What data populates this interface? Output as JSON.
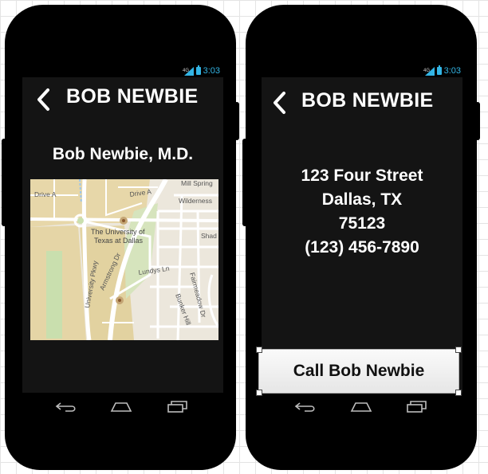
{
  "screens": [
    {
      "status": {
        "time": "3:03",
        "network": "4G"
      },
      "title": "BOB NEWBIE",
      "doctor_name": "Bob Newbie, M.D.",
      "map_labels": {
        "drive_a_1": "Drive A",
        "drive_a_2": "Drive A",
        "mill_spring": "Mill Spring",
        "wilderness": "Wilderness",
        "shad": "Shad",
        "ut_line1": "The University of",
        "ut_line2": "Texas at Dallas",
        "university_pkwy": "University Pkwy",
        "armstrong": "Armstrong Dr",
        "lundys": "Lundys Ln",
        "fairmeadow": "Fairmeadow Dr",
        "bunker_hill": "Bunker Hill"
      }
    },
    {
      "status": {
        "time": "3:03",
        "network": "4G"
      },
      "title": "BOB NEWBIE",
      "address": {
        "street": "123 Four Street",
        "city_state": "Dallas, TX",
        "zip": "75123",
        "phone": "(123) 456-7890"
      },
      "call_button": "Call Bob Newbie"
    }
  ],
  "colors": {
    "status_accent": "#33b5e5",
    "screen_bg": "#141414",
    "phone_body": "#000000"
  },
  "icons": [
    "back-chevron-icon",
    "nav-back-icon",
    "nav-home-icon",
    "nav-recent-apps-icon",
    "signal-icon",
    "battery-icon",
    "map-marker-icon"
  ]
}
